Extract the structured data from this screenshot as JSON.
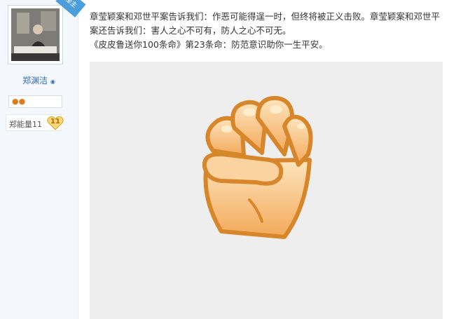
{
  "author": {
    "name": "郑渊洁",
    "corner_badge": "楼主",
    "energy_label": "郑能量11",
    "energy_level": "11"
  },
  "post": {
    "line1": "章莹颖案和邓世平案告诉我们：作恶可能得逞一时，但终将被正义击败。章莹颖案和邓世平",
    "line2": "案还告诉我们：害人之心不可有，防人之心不可无。",
    "line3": "《皮皮鲁送你100条命》第23条命：防范意识助你一生平安。",
    "image_icon": "fist-icon"
  },
  "colors": {
    "link": "#2f6db4",
    "sidebar_bg": "#f4f8fc",
    "fist_fill": "#f6b870",
    "fist_outline": "#d8862a",
    "badge_blue": "#4c9ddc"
  }
}
